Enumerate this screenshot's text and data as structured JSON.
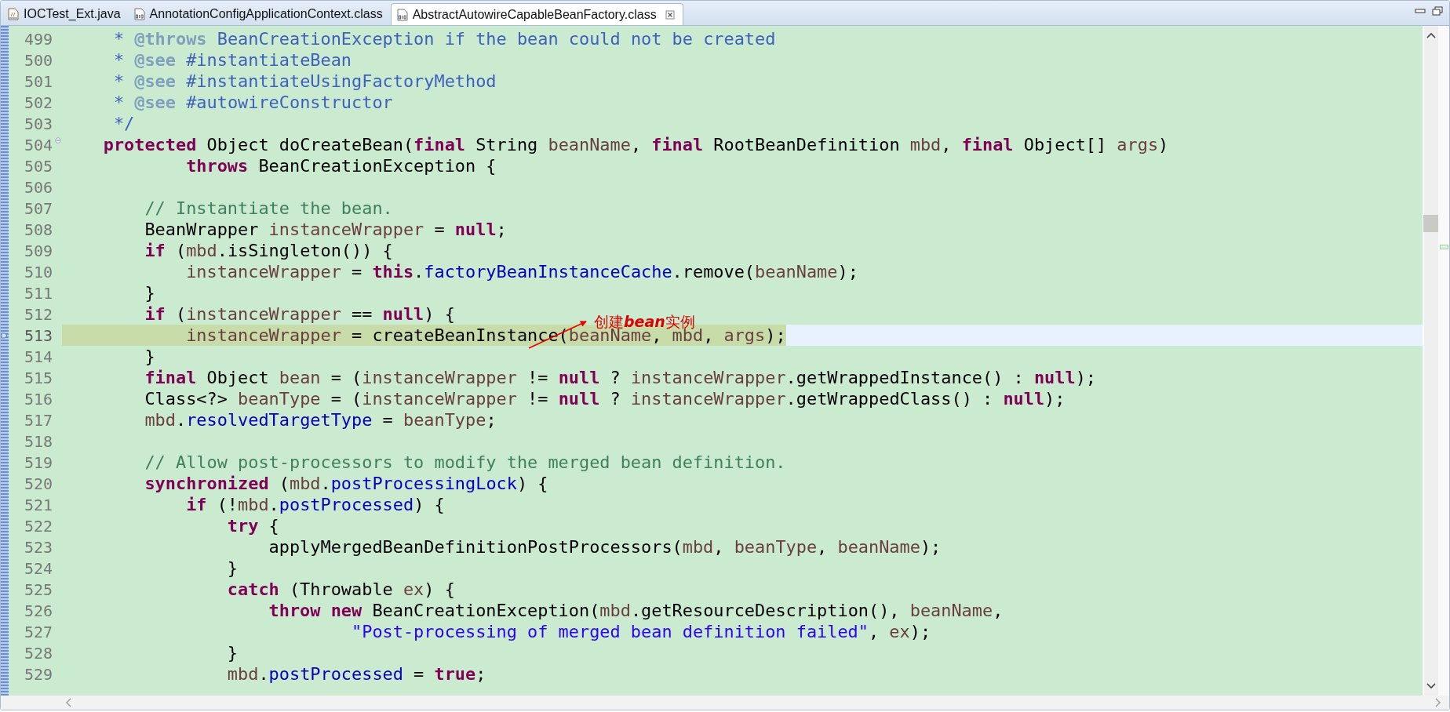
{
  "tabs": [
    {
      "label": "IOCTest_Ext.java",
      "kind": "java",
      "selected": false
    },
    {
      "label": "AnnotationConfigApplicationContext.class",
      "kind": "class",
      "selected": false
    },
    {
      "label": "AbstractAutowireCapableBeanFactory.class",
      "kind": "class",
      "selected": true
    }
  ],
  "editor": {
    "lines": [
      {
        "number": "499",
        "current": false,
        "foldable": false,
        "tokens": [
          {
            "kind": "jd",
            "text": "     * "
          },
          {
            "kind": "jt",
            "text": "@throws"
          },
          {
            "kind": "jd",
            "text": " BeanCreationException if the bean could not be created"
          }
        ]
      },
      {
        "number": "500",
        "current": false,
        "foldable": false,
        "tokens": [
          {
            "kind": "jd",
            "text": "     * "
          },
          {
            "kind": "jt",
            "text": "@see"
          },
          {
            "kind": "jd",
            "text": " #instantiateBean"
          }
        ]
      },
      {
        "number": "501",
        "current": false,
        "foldable": false,
        "tokens": [
          {
            "kind": "jd",
            "text": "     * "
          },
          {
            "kind": "jt",
            "text": "@see"
          },
          {
            "kind": "jd",
            "text": " #instantiateUsingFactoryMethod"
          }
        ]
      },
      {
        "number": "502",
        "current": false,
        "foldable": false,
        "tokens": [
          {
            "kind": "jd",
            "text": "     * "
          },
          {
            "kind": "jt",
            "text": "@see"
          },
          {
            "kind": "jd",
            "text": " #autowireConstructor"
          }
        ]
      },
      {
        "number": "503",
        "current": false,
        "foldable": false,
        "tokens": [
          {
            "kind": "jd",
            "text": "     */"
          }
        ]
      },
      {
        "number": "504",
        "current": false,
        "foldable": true,
        "tokens": [
          {
            "kind": "k",
            "text": "    protected"
          },
          {
            "kind": "p",
            "text": " Object doCreateBean("
          },
          {
            "kind": "k",
            "text": "final"
          },
          {
            "kind": "p",
            "text": " String "
          },
          {
            "kind": "v",
            "text": "beanName"
          },
          {
            "kind": "p",
            "text": ", "
          },
          {
            "kind": "k",
            "text": "final"
          },
          {
            "kind": "p",
            "text": " RootBeanDefinition "
          },
          {
            "kind": "v",
            "text": "mbd"
          },
          {
            "kind": "p",
            "text": ", "
          },
          {
            "kind": "k",
            "text": "final"
          },
          {
            "kind": "p",
            "text": " Object[] "
          },
          {
            "kind": "v",
            "text": "args"
          },
          {
            "kind": "p",
            "text": ")"
          }
        ]
      },
      {
        "number": "505",
        "current": false,
        "foldable": false,
        "tokens": [
          {
            "kind": "k",
            "text": "            throws"
          },
          {
            "kind": "p",
            "text": " BeanCreationException {"
          }
        ]
      },
      {
        "number": "506",
        "current": false,
        "foldable": false
      },
      {
        "number": "507",
        "current": false,
        "foldable": false,
        "tokens": [
          {
            "kind": "c",
            "text": "        // Instantiate the bean."
          }
        ]
      },
      {
        "number": "508",
        "current": false,
        "foldable": false,
        "tokens": [
          {
            "kind": "p",
            "text": "        BeanWrapper "
          },
          {
            "kind": "v",
            "text": "instanceWrapper"
          },
          {
            "kind": "p",
            "text": " = "
          },
          {
            "kind": "k",
            "text": "null"
          },
          {
            "kind": "p",
            "text": ";"
          }
        ]
      },
      {
        "number": "509",
        "current": false,
        "foldable": false,
        "tokens": [
          {
            "kind": "k",
            "text": "        if"
          },
          {
            "kind": "p",
            "text": " ("
          },
          {
            "kind": "v",
            "text": "mbd"
          },
          {
            "kind": "p",
            "text": ".isSingleton()) {"
          }
        ]
      },
      {
        "number": "510",
        "current": false,
        "foldable": false,
        "tokens": [
          {
            "kind": "v",
            "text": "            instanceWrapper"
          },
          {
            "kind": "p",
            "text": " = "
          },
          {
            "kind": "k",
            "text": "this"
          },
          {
            "kind": "p",
            "text": "."
          },
          {
            "kind": "f",
            "text": "factoryBeanInstanceCache"
          },
          {
            "kind": "p",
            "text": ".remove("
          },
          {
            "kind": "v",
            "text": "beanName"
          },
          {
            "kind": "p",
            "text": ");"
          }
        ]
      },
      {
        "number": "511",
        "current": false,
        "foldable": false,
        "tokens": [
          {
            "kind": "p",
            "text": "        }"
          }
        ]
      },
      {
        "number": "512",
        "current": false,
        "foldable": false,
        "tokens": [
          {
            "kind": "k",
            "text": "        if"
          },
          {
            "kind": "p",
            "text": " ("
          },
          {
            "kind": "v",
            "text": "instanceWrapper"
          },
          {
            "kind": "p",
            "text": " == "
          },
          {
            "kind": "k",
            "text": "null"
          },
          {
            "kind": "p",
            "text": ") {"
          }
        ]
      },
      {
        "number": "513",
        "current": true,
        "foldable": false,
        "tokens": [
          {
            "kind": "v",
            "text": "            instanceWrapper"
          },
          {
            "kind": "p",
            "text": " = createBeanInstance("
          },
          {
            "kind": "v",
            "text": "beanName"
          },
          {
            "kind": "p",
            "text": ", "
          },
          {
            "kind": "v",
            "text": "mbd"
          },
          {
            "kind": "p",
            "text": ", "
          },
          {
            "kind": "v",
            "text": "args"
          },
          {
            "kind": "p",
            "text": ");"
          }
        ]
      },
      {
        "number": "514",
        "current": false,
        "foldable": false,
        "tokens": [
          {
            "kind": "p",
            "text": "        }"
          }
        ]
      },
      {
        "number": "515",
        "current": false,
        "foldable": false,
        "tokens": [
          {
            "kind": "k",
            "text": "        final"
          },
          {
            "kind": "p",
            "text": " Object "
          },
          {
            "kind": "v",
            "text": "bean"
          },
          {
            "kind": "p",
            "text": " = ("
          },
          {
            "kind": "v",
            "text": "instanceWrapper"
          },
          {
            "kind": "p",
            "text": " != "
          },
          {
            "kind": "k",
            "text": "null"
          },
          {
            "kind": "p",
            "text": " ? "
          },
          {
            "kind": "v",
            "text": "instanceWrapper"
          },
          {
            "kind": "p",
            "text": ".getWrappedInstance() : "
          },
          {
            "kind": "k",
            "text": "null"
          },
          {
            "kind": "p",
            "text": ");"
          }
        ]
      },
      {
        "number": "516",
        "current": false,
        "foldable": false,
        "tokens": [
          {
            "kind": "p",
            "text": "        Class<?> "
          },
          {
            "kind": "v",
            "text": "beanType"
          },
          {
            "kind": "p",
            "text": " = ("
          },
          {
            "kind": "v",
            "text": "instanceWrapper"
          },
          {
            "kind": "p",
            "text": " != "
          },
          {
            "kind": "k",
            "text": "null"
          },
          {
            "kind": "p",
            "text": " ? "
          },
          {
            "kind": "v",
            "text": "instanceWrapper"
          },
          {
            "kind": "p",
            "text": ".getWrappedClass() : "
          },
          {
            "kind": "k",
            "text": "null"
          },
          {
            "kind": "p",
            "text": ");"
          }
        ]
      },
      {
        "number": "517",
        "current": false,
        "foldable": false,
        "tokens": [
          {
            "kind": "v",
            "text": "        mbd"
          },
          {
            "kind": "p",
            "text": "."
          },
          {
            "kind": "f",
            "text": "resolvedTargetType"
          },
          {
            "kind": "p",
            "text": " = "
          },
          {
            "kind": "v",
            "text": "beanType"
          },
          {
            "kind": "p",
            "text": ";"
          }
        ]
      },
      {
        "number": "518",
        "current": false,
        "foldable": false
      },
      {
        "number": "519",
        "current": false,
        "foldable": false,
        "tokens": [
          {
            "kind": "c",
            "text": "        // Allow post-processors to modify the merged bean definition."
          }
        ]
      },
      {
        "number": "520",
        "current": false,
        "foldable": false,
        "tokens": [
          {
            "kind": "k",
            "text": "        synchronized"
          },
          {
            "kind": "p",
            "text": " ("
          },
          {
            "kind": "v",
            "text": "mbd"
          },
          {
            "kind": "p",
            "text": "."
          },
          {
            "kind": "f",
            "text": "postProcessingLock"
          },
          {
            "kind": "p",
            "text": ") {"
          }
        ]
      },
      {
        "number": "521",
        "current": false,
        "foldable": false,
        "tokens": [
          {
            "kind": "k",
            "text": "            if"
          },
          {
            "kind": "p",
            "text": " (!"
          },
          {
            "kind": "v",
            "text": "mbd"
          },
          {
            "kind": "p",
            "text": "."
          },
          {
            "kind": "f",
            "text": "postProcessed"
          },
          {
            "kind": "p",
            "text": ") {"
          }
        ]
      },
      {
        "number": "522",
        "current": false,
        "foldable": false,
        "tokens": [
          {
            "kind": "k",
            "text": "                try"
          },
          {
            "kind": "p",
            "text": " {"
          }
        ]
      },
      {
        "number": "523",
        "current": false,
        "foldable": false,
        "tokens": [
          {
            "kind": "p",
            "text": "                    applyMergedBeanDefinitionPostProcessors("
          },
          {
            "kind": "v",
            "text": "mbd"
          },
          {
            "kind": "p",
            "text": ", "
          },
          {
            "kind": "v",
            "text": "beanType"
          },
          {
            "kind": "p",
            "text": ", "
          },
          {
            "kind": "v",
            "text": "beanName"
          },
          {
            "kind": "p",
            "text": ");"
          }
        ]
      },
      {
        "number": "524",
        "current": false,
        "foldable": false,
        "tokens": [
          {
            "kind": "p",
            "text": "                }"
          }
        ]
      },
      {
        "number": "525",
        "current": false,
        "foldable": false,
        "tokens": [
          {
            "kind": "k",
            "text": "                catch"
          },
          {
            "kind": "p",
            "text": " (Throwable "
          },
          {
            "kind": "v",
            "text": "ex"
          },
          {
            "kind": "p",
            "text": ") {"
          }
        ]
      },
      {
        "number": "526",
        "current": false,
        "foldable": false,
        "tokens": [
          {
            "kind": "k",
            "text": "                    throw"
          },
          {
            "kind": "k",
            "text": " new"
          },
          {
            "kind": "p",
            "text": " BeanCreationException("
          },
          {
            "kind": "v",
            "text": "mbd"
          },
          {
            "kind": "p",
            "text": ".getResourceDescription(), "
          },
          {
            "kind": "v",
            "text": "beanName"
          },
          {
            "kind": "p",
            "text": ","
          }
        ]
      },
      {
        "number": "527",
        "current": false,
        "foldable": false,
        "tokens": [
          {
            "kind": "s",
            "text": "                            \"Post-processing of merged bean definition failed\""
          },
          {
            "kind": "p",
            "text": ", "
          },
          {
            "kind": "v",
            "text": "ex"
          },
          {
            "kind": "p",
            "text": ");"
          }
        ]
      },
      {
        "number": "528",
        "current": false,
        "foldable": false,
        "tokens": [
          {
            "kind": "p",
            "text": "                }"
          }
        ]
      },
      {
        "number": "529",
        "current": false,
        "foldable": false,
        "tokens": [
          {
            "kind": "v",
            "text": "                mbd"
          },
          {
            "kind": "p",
            "text": "."
          },
          {
            "kind": "f",
            "text": "postProcessed"
          },
          {
            "kind": "p",
            "text": " = "
          },
          {
            "kind": "k",
            "text": "true"
          },
          {
            "kind": "p",
            "text": ";"
          }
        ]
      }
    ]
  },
  "annotation": {
    "text": "创建**bean**实例"
  }
}
